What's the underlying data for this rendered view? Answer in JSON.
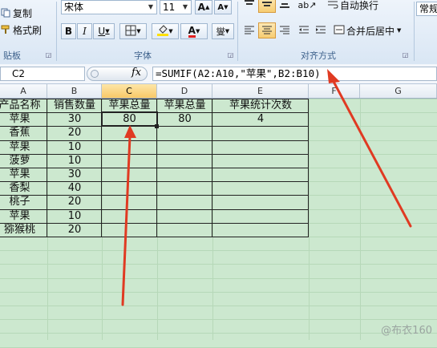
{
  "ribbon": {
    "clipboard": {
      "copy_label": "复制",
      "format_painter_label": "格式刷",
      "group_label": "贴板"
    },
    "font": {
      "font_name": "宋体",
      "font_size": "11",
      "grow_label": "A",
      "shrink_label": "A",
      "bold_label": "B",
      "italic_label": "I",
      "underline_label": "U",
      "wen_label": "燮",
      "group_label": "字体"
    },
    "alignment": {
      "wrap_text_label": "自动换行",
      "merge_center_label": "合并后居中",
      "group_label": "对齐方式"
    },
    "number": {
      "format_label": "常规"
    }
  },
  "formula_bar": {
    "name_box": "C2",
    "fx_label": "fx",
    "formula": "=SUMIF(A2:A10,\"苹果\",B2:B10)"
  },
  "columns": [
    "A",
    "B",
    "C",
    "D",
    "E",
    "F",
    "G"
  ],
  "table": {
    "headers": [
      "产品名称",
      "销售数量",
      "苹果总量",
      "苹果总量",
      "苹果统计次数"
    ],
    "rows": [
      [
        "苹果",
        "30",
        "80",
        "80",
        "4"
      ],
      [
        "香蕉",
        "20",
        "",
        "",
        ""
      ],
      [
        "苹果",
        "10",
        "",
        "",
        ""
      ],
      [
        "菠萝",
        "10",
        "",
        "",
        ""
      ],
      [
        "苹果",
        "30",
        "",
        "",
        ""
      ],
      [
        "香梨",
        "40",
        "",
        "",
        ""
      ],
      [
        "桃子",
        "20",
        "",
        "",
        ""
      ],
      [
        "苹果",
        "10",
        "",
        "",
        ""
      ],
      [
        "猕猴桃",
        "20",
        "",
        "",
        ""
      ]
    ]
  },
  "watermark": "@布衣160",
  "colors": {
    "sheet_background": "#cce8cf",
    "arrow": "#e03a22",
    "selected_header": "#f8c867"
  }
}
